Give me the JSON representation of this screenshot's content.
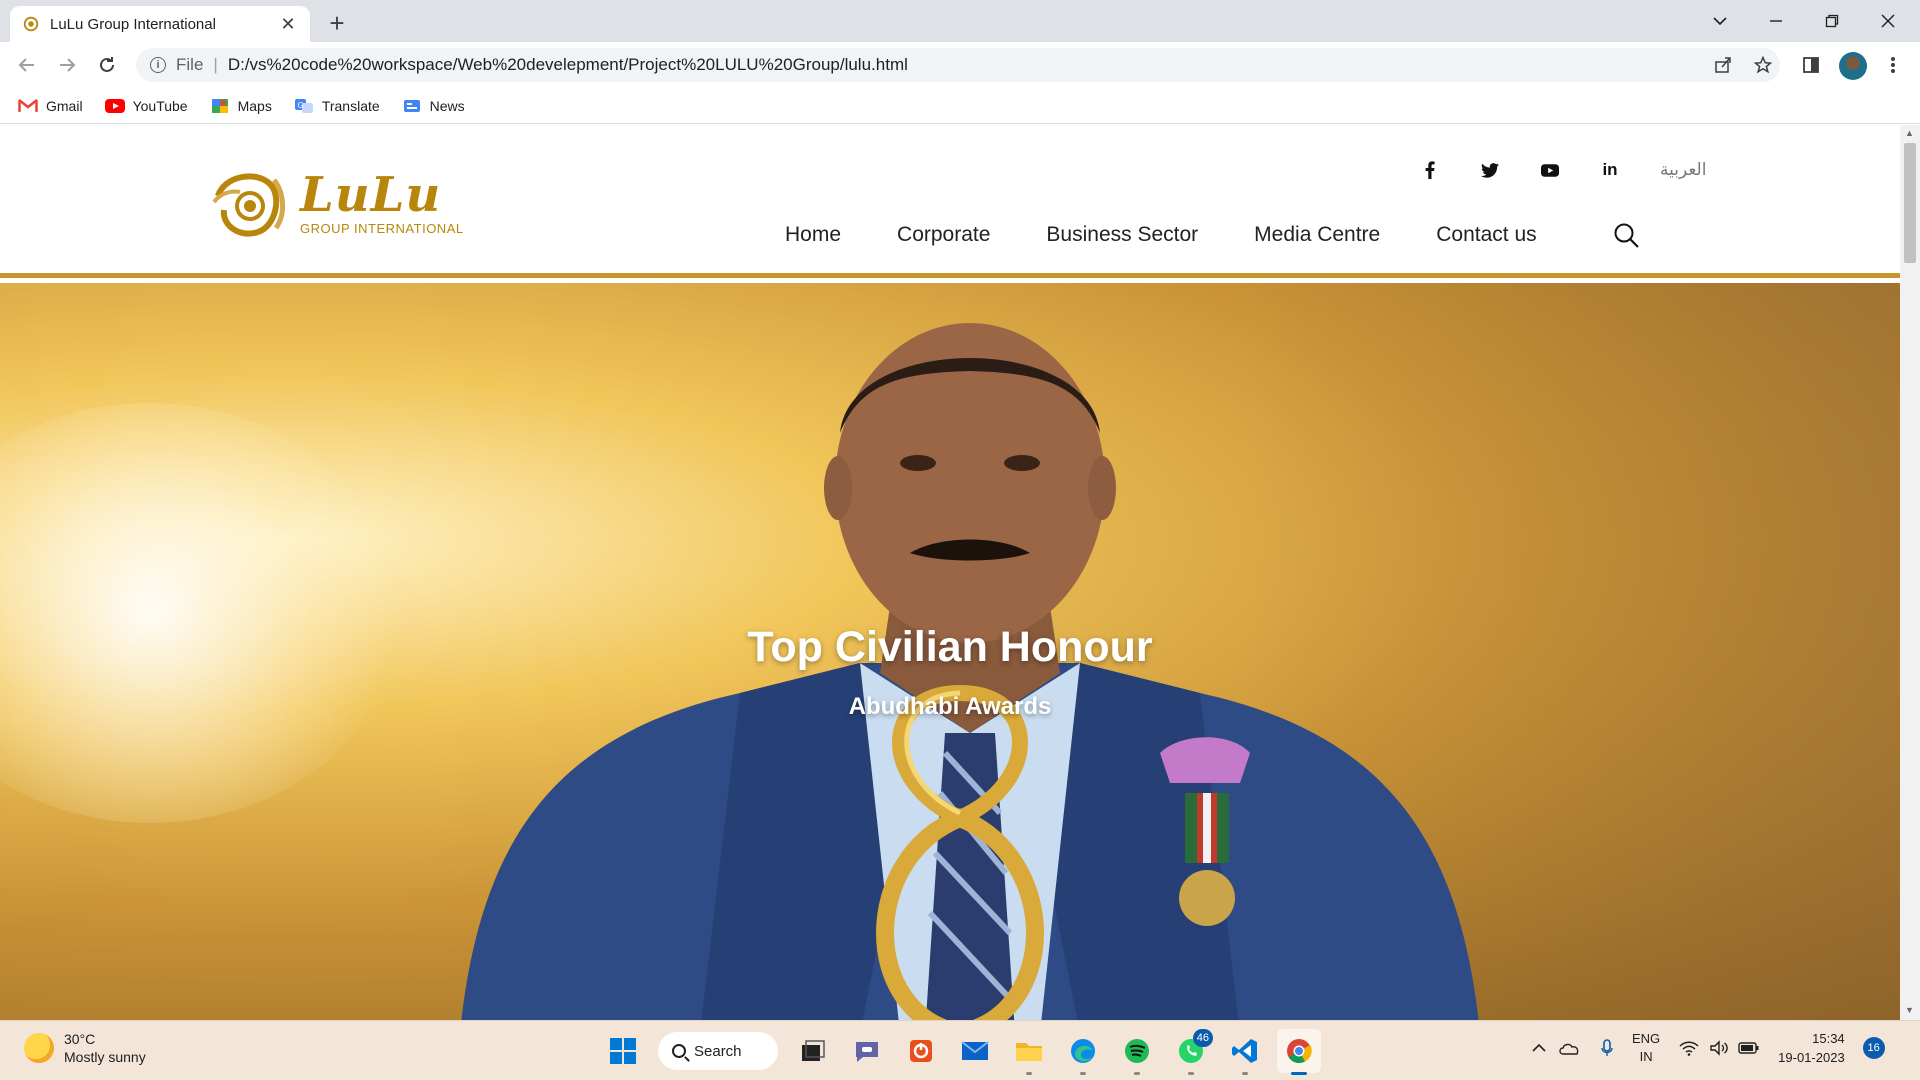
{
  "browser": {
    "tab_title": "LuLu Group International",
    "tab_close": "✕",
    "new_tab": "+",
    "address_scheme": "File",
    "address_url": "D:/vs%20code%20workspace/Web%20develepment/Project%20LULU%20Group/lulu.html",
    "bookmarks": [
      {
        "label": "Gmail",
        "icon": "gmail-icon",
        "color": "#ea4335"
      },
      {
        "label": "YouTube",
        "icon": "youtube-icon",
        "color": "#ff0000"
      },
      {
        "label": "Maps",
        "icon": "maps-icon",
        "color": "#34a853"
      },
      {
        "label": "Translate",
        "icon": "translate-icon",
        "color": "#4285f4"
      },
      {
        "label": "News",
        "icon": "news-icon",
        "color": "#4285f4"
      }
    ]
  },
  "site": {
    "logo_word": "LuLu",
    "logo_sub": "GROUP INTERNATIONAL",
    "social": {
      "facebook": "f",
      "twitter": "t",
      "youtube": "▶",
      "linkedin": "in"
    },
    "arabic_link": "العربية",
    "nav": [
      "Home",
      "Corporate",
      "Business Sector",
      "Media Centre",
      "Contact us"
    ],
    "hero": {
      "title": "Top Civilian Honour",
      "subtitle": "Abudhabi Awards"
    },
    "colors": {
      "accent": "#c8952a",
      "logo": "#b8860b"
    }
  },
  "taskbar": {
    "weather_temp": "30°C",
    "weather_desc": "Mostly sunny",
    "search_label": "Search",
    "whatsapp_badge": "46",
    "lang_line1": "ENG",
    "lang_line2": "IN",
    "time": "15:34",
    "date": "19-01-2023",
    "notifications": "16"
  }
}
